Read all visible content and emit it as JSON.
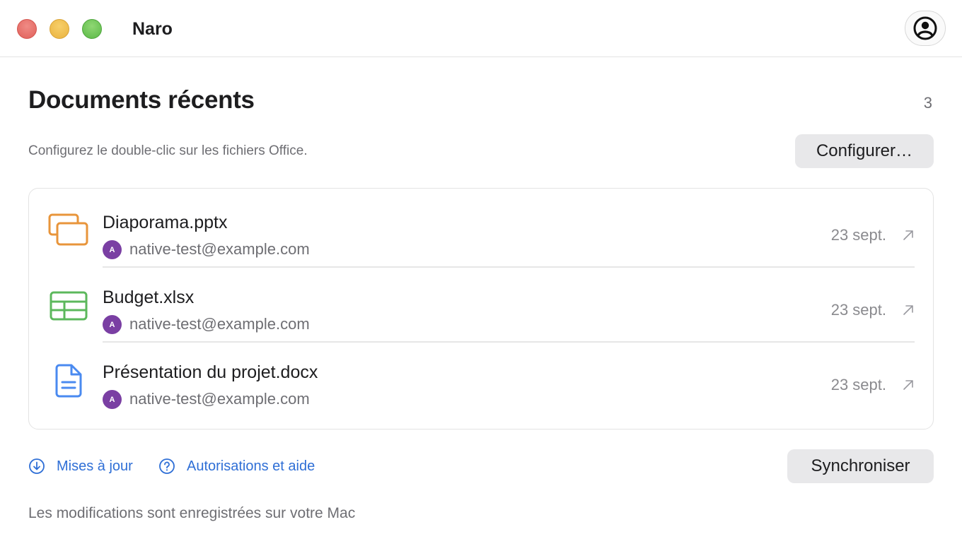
{
  "window": {
    "title": "Naro"
  },
  "header": {
    "heading": "Documents récents",
    "count": "3",
    "subtitle": "Configurez le double-clic sur les fichiers Office.",
    "configure_label": "Configurer…"
  },
  "documents": [
    {
      "name": "Diaporama.pptx",
      "avatar": "A",
      "owner": "native-test@example.com",
      "date": "23 sept.",
      "icon": "presentation-icon",
      "color": "#e8953b"
    },
    {
      "name": "Budget.xlsx",
      "avatar": "A",
      "owner": "native-test@example.com",
      "date": "23 sept.",
      "icon": "spreadsheet-icon",
      "color": "#5cb85c"
    },
    {
      "name": "Présentation du projet.docx",
      "avatar": "A",
      "owner": "native-test@example.com",
      "date": "23 sept.",
      "icon": "document-icon",
      "color": "#4a8af0"
    }
  ],
  "links": {
    "updates": "Mises à jour",
    "help": "Autorisations et aide"
  },
  "sync_label": "Synchroniser",
  "footer": "Les modifications sont enregistrées sur votre Mac",
  "colors": {
    "accent": "#2f6fd6",
    "avatar": "#7a3fa3"
  }
}
